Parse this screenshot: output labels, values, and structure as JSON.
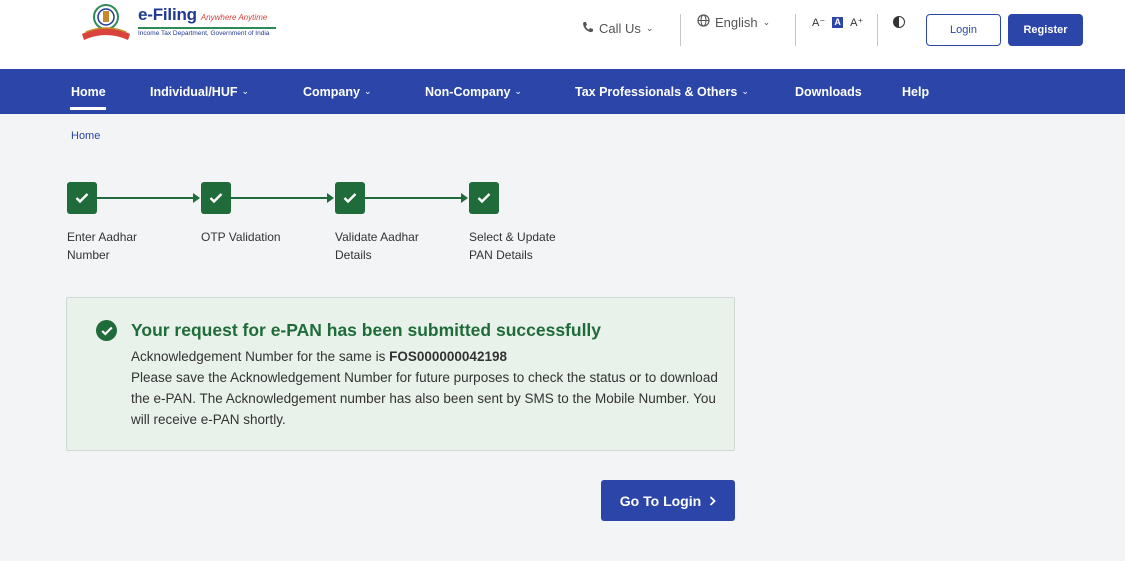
{
  "header": {
    "brand_title": "e-Filing",
    "brand_tagline": "Anywhere Anytime",
    "brand_subtitle": "Income Tax Department, Government of India",
    "call_us": "Call Us",
    "language": "English",
    "font_smaller": "A⁻",
    "font_default": "A",
    "font_larger": "A⁺",
    "login_label": "Login",
    "register_label": "Register"
  },
  "nav": {
    "items": [
      {
        "label": "Home",
        "has_dropdown": false
      },
      {
        "label": "Individual/HUF",
        "has_dropdown": true
      },
      {
        "label": "Company",
        "has_dropdown": true
      },
      {
        "label": "Non-Company",
        "has_dropdown": true
      },
      {
        "label": "Tax Professionals & Others",
        "has_dropdown": true
      },
      {
        "label": "Downloads",
        "has_dropdown": false
      },
      {
        "label": "Help",
        "has_dropdown": false
      }
    ]
  },
  "breadcrumb": {
    "home": "Home"
  },
  "stepper": {
    "steps": [
      {
        "line1": "Enter Aadhar",
        "line2": "Number",
        "status": "completed"
      },
      {
        "line1": "OTP Validation",
        "line2": "",
        "status": "completed"
      },
      {
        "line1": "Validate Aadhar",
        "line2": "Details",
        "status": "completed"
      },
      {
        "line1": "Select & Update",
        "line2": "PAN Details",
        "status": "completed"
      }
    ]
  },
  "success": {
    "title": "Your request for e-PAN has been submitted successfully",
    "ack_prefix": "Acknowledgement Number for the same is ",
    "ack_number": "FOS000000042198",
    "message": "Please save the Acknowledgement Number for future purposes to check the status or to download the e-PAN. The Acknowledgement number has also been sent by SMS to the Mobile Number. You will receive e-PAN shortly."
  },
  "actions": {
    "go_to_login": "Go To Login"
  },
  "colors": {
    "primary": "#2b46a8",
    "success_green": "#1f6b3a",
    "success_bg": "#e8f2ea",
    "page_bg": "#f3f4f6"
  }
}
